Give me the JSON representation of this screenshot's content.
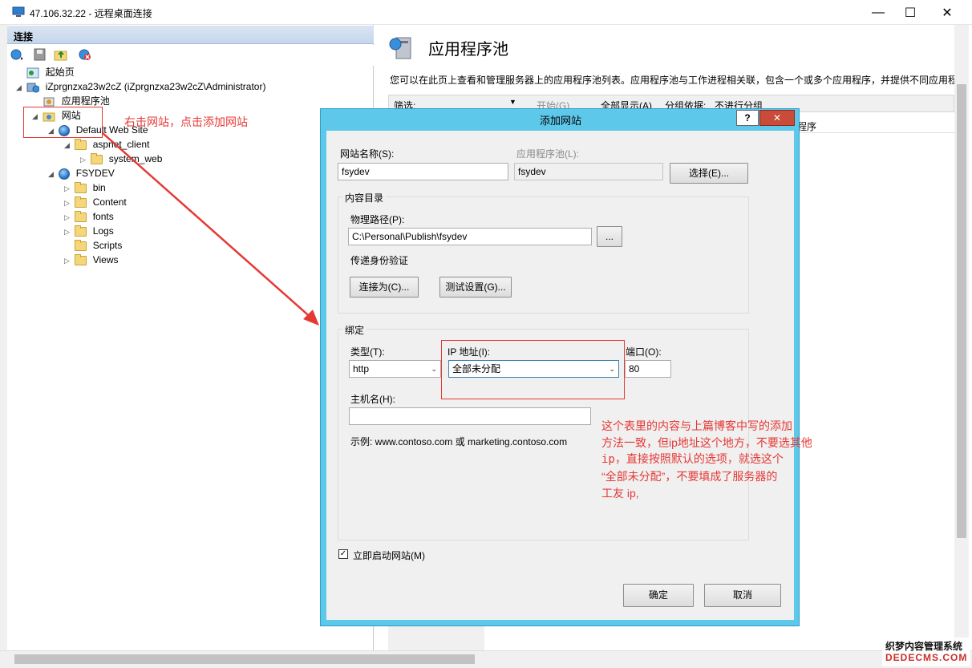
{
  "window": {
    "title": "47.106.32.22 - 远程桌面连接",
    "controls": [
      "—",
      "☐",
      "✕"
    ]
  },
  "connections": {
    "header": "连接",
    "tree": [
      {
        "label": "起始页",
        "icon": "start-page-icon"
      },
      {
        "label": "iZprgnzxa23w2cZ (iZprgnzxa23w2cZ\\Administrator)",
        "icon": "server-icon"
      },
      {
        "label": "应用程序池",
        "icon": "app-pool-icon"
      },
      {
        "label": "网站",
        "icon": "sites-icon"
      },
      {
        "label": "Default Web Site",
        "icon": "globe-icon"
      },
      {
        "label": "aspnet_client",
        "icon": "folder-icon"
      },
      {
        "label": "system_web",
        "icon": "folder-icon"
      },
      {
        "label": "FSYDEV",
        "icon": "globe-icon"
      },
      {
        "label": "bin",
        "icon": "folder-icon"
      },
      {
        "label": "Content",
        "icon": "folder-icon"
      },
      {
        "label": "fonts",
        "icon": "folder-icon"
      },
      {
        "label": "Logs",
        "icon": "folder-icon"
      },
      {
        "label": "Scripts",
        "icon": "folder-icon"
      },
      {
        "label": "Views",
        "icon": "folder-icon"
      }
    ]
  },
  "main": {
    "title": "应用程序池",
    "description": "您可以在此页上查看和管理服务器上的应用程序池列表。应用程序池与工作进程相关联，包含一个或多个应用程序，并提供不同应用程",
    "filter": {
      "label": "筛选:",
      "start": "开始(G)",
      "show_all": "全部显示(A)",
      "group_by": "分组依据:",
      "group_value": "不进行分组"
    },
    "column_partial": "程序"
  },
  "dialog": {
    "title": "添加网站",
    "help": "?",
    "close": "✕",
    "site_name_label": "网站名称(S):",
    "site_name_value": "fsydev",
    "app_pool_label": "应用程序池(L):",
    "app_pool_value": "fsydev",
    "select_button": "选择(E)...",
    "content_dir_title": "内容目录",
    "physical_path_label": "物理路径(P):",
    "physical_path_value": "C:\\Personal\\Publish\\fsydev",
    "browse_button": "...",
    "pass_auth_label": "传递身份验证",
    "connect_as_button": "连接为(C)...",
    "test_settings_button": "测试设置(G)...",
    "binding_title": "绑定",
    "type_label": "类型(T):",
    "type_value": "http",
    "ip_label": "IP 地址(I):",
    "ip_value": "全部未分配",
    "port_label": "端口(O):",
    "port_value": "80",
    "host_label": "主机名(H):",
    "host_value": "",
    "example_text": "示例: www.contoso.com 或 marketing.contoso.com",
    "start_site_label": "立即启动网站(M)",
    "start_site_checked": true,
    "ok_button": "确定",
    "cancel_button": "取消"
  },
  "annotations": {
    "sites_note": "右击网站，点击添加网站",
    "ip_note_lines": [
      "这个表里的内容与上篇博客中写的添加",
      "方法一致，但ip地址这个地方，不要选其他",
      "ip，直接按照默认的选项，就选这个",
      "“全部未分配”，不要填成了服务器的",
      "工友 ip,"
    ]
  },
  "watermark": {
    "line1": "织梦内容管理系统",
    "line2": "DEDECMS.COM"
  },
  "colors": {
    "dialog_frame": "#5ec8ea",
    "annotation": "#e53935",
    "close_button": "#c94b3a"
  }
}
